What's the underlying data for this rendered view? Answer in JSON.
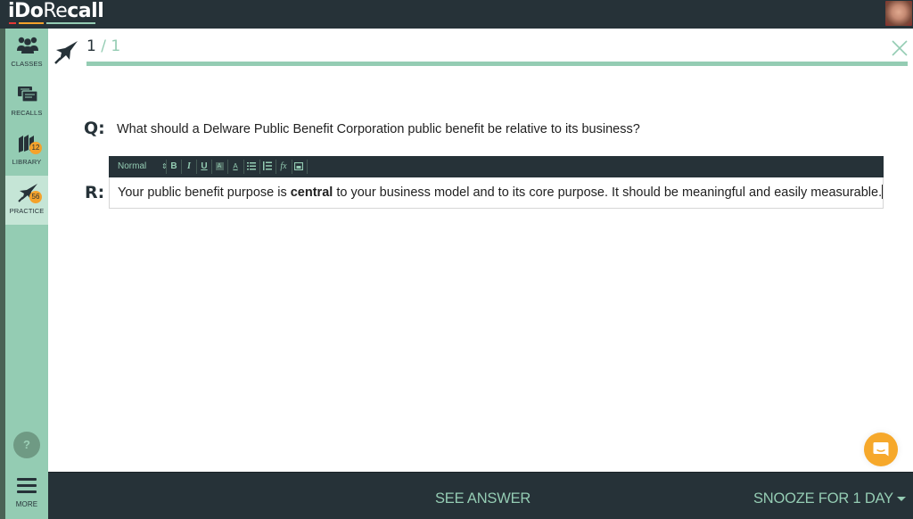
{
  "app": {
    "logo_bold_left": "iDo",
    "logo_light": "Re",
    "logo_tail": "call",
    "logo_bar_colors": [
      "#e53935",
      "#f4a22b",
      "#94ccb3"
    ]
  },
  "sidebar": {
    "items": [
      {
        "label": "CLASSES",
        "icon": "classes-icon",
        "badge": null
      },
      {
        "label": "RECALLS",
        "icon": "recalls-icon",
        "badge": null
      },
      {
        "label": "LIBRARY",
        "icon": "library-icon",
        "badge": "12"
      },
      {
        "label": "PRACTICE",
        "icon": "rocket-icon",
        "badge": "56",
        "active": true
      }
    ],
    "help_label": "?",
    "more_label": "MORE"
  },
  "practice": {
    "current": "1",
    "separator": "/",
    "total": "1",
    "progress": 1.0,
    "question_label": "Q:",
    "question": "What should a Delware Public Benefit Corporation public benefit be relative to its business?",
    "response_label": "R:",
    "response_before": "Your public benefit purpose is ",
    "response_bold": "central",
    "response_after": " to your business model and to its core purpose. It should be meaningful and easily measurable."
  },
  "editor_toolbar": {
    "format_select": "Normal",
    "buttons": [
      "B",
      "I",
      "U",
      "A",
      "A",
      "bullet-list",
      "ordered-list",
      "fx",
      "image"
    ]
  },
  "bottom": {
    "see_answer": "SEE ANSWER",
    "snooze": "SNOOZE FOR 1 DAY"
  },
  "colors": {
    "dark": "#263238",
    "accent": "#94ccb3",
    "badge": "#f4a22b"
  }
}
